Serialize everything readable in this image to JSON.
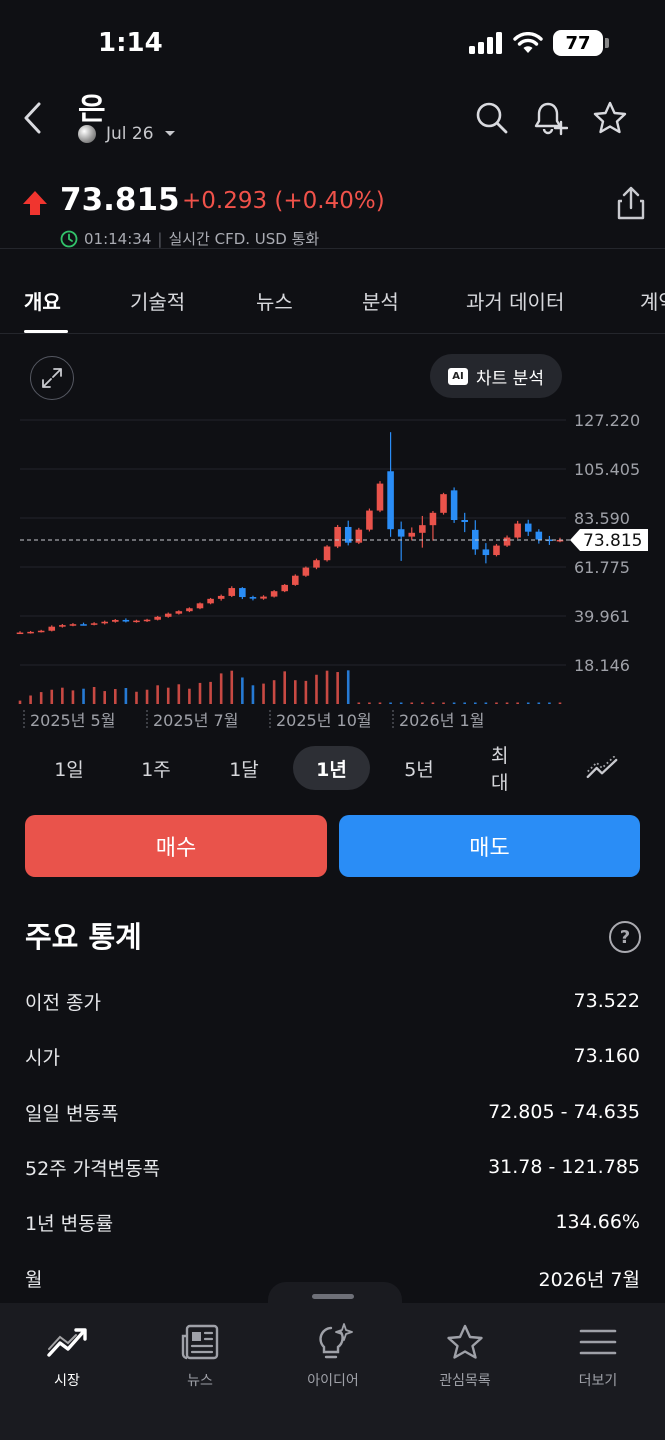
{
  "status_bar": {
    "time": "1:14",
    "battery": "77"
  },
  "header": {
    "title": "은",
    "contract": "Jul 26"
  },
  "quote": {
    "price": "73.815",
    "change": "+0.293 (+0.40%)",
    "time": "01:14:34",
    "info": "실시간 CFD. USD 통화"
  },
  "tabs": [
    {
      "label": "개요"
    },
    {
      "label": "기술적"
    },
    {
      "label": "뉴스"
    },
    {
      "label": "분석"
    },
    {
      "label": "과거 데이터"
    },
    {
      "label": "계약"
    }
  ],
  "chart_toolbar": {
    "ai_label": "차트 분석",
    "ai_badge": "AI"
  },
  "chart_data": {
    "type": "candlestick",
    "y_ticks": [
      "127.220",
      "105.405",
      "83.590",
      "61.775",
      "39.961",
      "18.146"
    ],
    "y_range": [
      18.146,
      127.22
    ],
    "x_ticks": [
      "2025년 5월",
      "2025년 7월",
      "2025년 10월",
      "2026년 1월"
    ],
    "last_price": 73.815,
    "last_price_label": "73.815",
    "grid": true,
    "colors": {
      "up": "#e9534b",
      "down": "#2a8df6"
    },
    "candles": [
      {
        "o": 32.4,
        "h": 33.2,
        "l": 32.0,
        "c": 32.6
      },
      {
        "o": 32.6,
        "h": 33.3,
        "l": 32.1,
        "c": 32.9
      },
      {
        "o": 32.9,
        "h": 33.8,
        "l": 32.6,
        "c": 33.4
      },
      {
        "o": 33.4,
        "h": 35.8,
        "l": 33.1,
        "c": 35.2
      },
      {
        "o": 35.2,
        "h": 36.4,
        "l": 34.8,
        "c": 35.9
      },
      {
        "o": 35.9,
        "h": 36.8,
        "l": 35.4,
        "c": 36.3
      },
      {
        "o": 36.3,
        "h": 37.0,
        "l": 35.7,
        "c": 36.1
      },
      {
        "o": 36.1,
        "h": 37.2,
        "l": 35.8,
        "c": 36.7
      },
      {
        "o": 36.7,
        "h": 37.9,
        "l": 36.2,
        "c": 37.4
      },
      {
        "o": 37.4,
        "h": 38.6,
        "l": 37.0,
        "c": 38.2
      },
      {
        "o": 38.2,
        "h": 38.9,
        "l": 37.1,
        "c": 37.5
      },
      {
        "o": 37.5,
        "h": 38.3,
        "l": 37.0,
        "c": 37.9
      },
      {
        "o": 37.9,
        "h": 38.7,
        "l": 37.3,
        "c": 38.3
      },
      {
        "o": 38.3,
        "h": 40.0,
        "l": 38.0,
        "c": 39.6
      },
      {
        "o": 39.6,
        "h": 41.5,
        "l": 39.2,
        "c": 41.0
      },
      {
        "o": 41.0,
        "h": 42.5,
        "l": 40.6,
        "c": 42.1
      },
      {
        "o": 42.1,
        "h": 43.8,
        "l": 41.7,
        "c": 43.4
      },
      {
        "o": 43.4,
        "h": 46.0,
        "l": 43.0,
        "c": 45.6
      },
      {
        "o": 45.6,
        "h": 48.0,
        "l": 45.2,
        "c": 47.6
      },
      {
        "o": 47.6,
        "h": 49.5,
        "l": 46.8,
        "c": 48.9
      },
      {
        "o": 48.9,
        "h": 53.2,
        "l": 48.4,
        "c": 52.4
      },
      {
        "o": 52.4,
        "h": 52.8,
        "l": 47.5,
        "c": 48.4
      },
      {
        "o": 48.4,
        "h": 49.0,
        "l": 46.9,
        "c": 47.7
      },
      {
        "o": 47.7,
        "h": 49.2,
        "l": 47.2,
        "c": 48.6
      },
      {
        "o": 48.6,
        "h": 51.5,
        "l": 48.2,
        "c": 51.0
      },
      {
        "o": 51.0,
        "h": 54.2,
        "l": 50.6,
        "c": 53.8
      },
      {
        "o": 53.8,
        "h": 58.5,
        "l": 53.4,
        "c": 57.9
      },
      {
        "o": 57.9,
        "h": 62.0,
        "l": 57.4,
        "c": 61.5
      },
      {
        "o": 61.5,
        "h": 65.5,
        "l": 60.8,
        "c": 64.8
      },
      {
        "o": 64.8,
        "h": 71.5,
        "l": 64.2,
        "c": 70.9
      },
      {
        "o": 70.9,
        "h": 80.5,
        "l": 70.2,
        "c": 79.6
      },
      {
        "o": 79.6,
        "h": 82.4,
        "l": 71.4,
        "c": 72.6
      },
      {
        "o": 72.6,
        "h": 79.2,
        "l": 72.0,
        "c": 78.4
      },
      {
        "o": 78.4,
        "h": 87.8,
        "l": 77.6,
        "c": 86.9
      },
      {
        "o": 86.9,
        "h": 100.0,
        "l": 86.2,
        "c": 98.9
      },
      {
        "o": 104.4,
        "h": 121.8,
        "l": 75.2,
        "c": 78.6
      },
      {
        "o": 78.6,
        "h": 82.0,
        "l": 64.5,
        "c": 75.3
      },
      {
        "o": 75.3,
        "h": 79.4,
        "l": 73.6,
        "c": 77.0
      },
      {
        "o": 77.0,
        "h": 84.5,
        "l": 70.4,
        "c": 80.4
      },
      {
        "o": 80.4,
        "h": 86.7,
        "l": 73.5,
        "c": 85.9
      },
      {
        "o": 85.9,
        "h": 94.8,
        "l": 85.1,
        "c": 94.2
      },
      {
        "o": 95.9,
        "h": 97.2,
        "l": 81.4,
        "c": 82.7
      },
      {
        "o": 82.7,
        "h": 85.9,
        "l": 77.3,
        "c": 81.8
      },
      {
        "o": 78.3,
        "h": 82.6,
        "l": 67.2,
        "c": 69.6
      },
      {
        "o": 69.6,
        "h": 72.4,
        "l": 63.4,
        "c": 67.1
      },
      {
        "o": 67.1,
        "h": 72.0,
        "l": 66.5,
        "c": 71.3
      },
      {
        "o": 71.3,
        "h": 75.8,
        "l": 70.7,
        "c": 74.9
      },
      {
        "o": 74.9,
        "h": 82.3,
        "l": 74.3,
        "c": 81.1
      },
      {
        "o": 81.1,
        "h": 82.8,
        "l": 75.6,
        "c": 77.5
      },
      {
        "o": 77.5,
        "h": 78.6,
        "l": 72.2,
        "c": 74.0
      },
      {
        "o": 74.0,
        "h": 75.6,
        "l": 71.6,
        "c": 73.5
      },
      {
        "o": 73.5,
        "h": 74.8,
        "l": 72.8,
        "c": 73.815
      }
    ],
    "volumes": [
      0.1,
      0.25,
      0.35,
      0.42,
      0.48,
      0.4,
      0.45,
      0.5,
      0.38,
      0.44,
      0.47,
      0.36,
      0.42,
      0.55,
      0.48,
      0.58,
      0.45,
      0.62,
      0.65,
      0.9,
      0.98,
      0.78,
      0.55,
      0.6,
      0.7,
      0.96,
      0.7,
      0.68,
      0.86,
      0.98,
      0.94,
      0.99,
      0.01,
      0.01,
      0.01,
      0.02,
      0.02,
      0.01,
      0.01,
      0.01,
      0.01,
      0.02,
      0.01,
      0.02,
      0.01,
      0.01,
      0.01,
      0.01,
      0.01,
      0.01,
      0.02,
      0.03
    ]
  },
  "ranges": [
    {
      "label": "1일"
    },
    {
      "label": "1주"
    },
    {
      "label": "1달"
    },
    {
      "label": "1년",
      "active": true
    },
    {
      "label": "5년"
    },
    {
      "label": "최대"
    }
  ],
  "actions": {
    "buy": "매수",
    "sell": "매도"
  },
  "stats": {
    "title": "주요 통계",
    "help": "?",
    "rows": [
      {
        "label": "이전 종가",
        "value": "73.522"
      },
      {
        "label": "시가",
        "value": "73.160"
      },
      {
        "label": "일일 변동폭",
        "value": "72.805 - 74.635"
      },
      {
        "label": "52주 가격변동폭",
        "value": "31.78 - 121.785"
      },
      {
        "label": "1년 변동률",
        "value": "134.66%"
      },
      {
        "label": "월",
        "value": "2026년 7월"
      }
    ]
  },
  "bottom_nav": [
    {
      "label": "시장",
      "icon": "chart-trend-icon",
      "active": true
    },
    {
      "label": "뉴스",
      "icon": "newspaper-icon"
    },
    {
      "label": "아이디어",
      "icon": "lightbulb-icon"
    },
    {
      "label": "관심목록",
      "icon": "star-icon"
    },
    {
      "label": "더보기",
      "icon": "menu-icon"
    }
  ]
}
